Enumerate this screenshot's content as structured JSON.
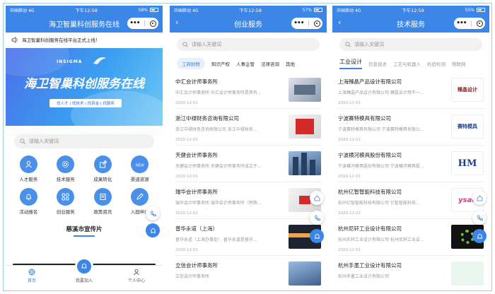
{
  "status_bar": {
    "carrier": "中国移动",
    "network": "4G",
    "time_p1": "下午12:58",
    "time_p2": "下午12:58",
    "time_p3": "下午12:59",
    "battery_p1": "58%",
    "battery_p2": "57%",
    "battery_p3": "55%"
  },
  "phone1": {
    "title": "海卫智巢科创服务在线",
    "notice": "海卫智巢科创服务在线平台正式上线！",
    "banner": {
      "brand": "INSIGMA",
      "headline": "海卫智巢科创服务在线",
      "tagline": "找人才 | 找技术 | 找资金 | 找服务"
    },
    "search_placeholder": "请输入关键词",
    "grid": [
      {
        "label": "人才服务",
        "icon": "person-icon"
      },
      {
        "label": "技术服务",
        "icon": "gear-icon"
      },
      {
        "label": "成果转化",
        "icon": "share-icon"
      },
      {
        "label": "渠道资源",
        "icon": "channel-icon"
      },
      {
        "label": "活动报名",
        "icon": "bell-icon"
      },
      {
        "label": "创业服务",
        "icon": "apps-icon"
      },
      {
        "label": "政策资讯",
        "icon": "news-icon"
      },
      {
        "label": "入园申请",
        "icon": "pencil-icon"
      }
    ],
    "promo_title": "慈溪市宣传片",
    "tabs": [
      {
        "label": "首页"
      },
      {
        "label": "我要加入"
      },
      {
        "label": "个人中心"
      }
    ]
  },
  "phone2": {
    "title": "创业服务",
    "search_placeholder": "请输入关键词",
    "categories": [
      "工商财税",
      "知识产权",
      "人事企管",
      "法律咨询",
      "其他"
    ],
    "items": [
      {
        "title": "中汇会计师事务所",
        "desc": "中汇会计师事务所  中汇会计师事务所是具有...",
        "date": "2020-12-01"
      },
      {
        "title": "浙江中禄财务咨询有限公司",
        "desc": "浙江中禄财务咨询有限公司  浙江中禄财务...",
        "date": "2020-12-01"
      },
      {
        "title": "天健会计师事务所",
        "desc": "天健会计师事务所  天健会计师事务所成立于...",
        "date": "2020-12-01"
      },
      {
        "title": "瑞华会计师事务所",
        "desc": "瑞华会计师事务所  瑞华会计师事务所（特殊...",
        "date": "2020-12-01"
      },
      {
        "title": "普华永道（上海）",
        "desc": "普华永道（上海办事处）  普华永道是普华...",
        "date": "2020-12-01"
      },
      {
        "title": "立信会计师事务所",
        "desc": "立信会计师事务所",
        "date": ""
      }
    ]
  },
  "phone3": {
    "title": "技术服务",
    "search_placeholder": "请输入关键词",
    "categories": [
      "工业设计",
      "信息技术",
      "工艺与机器人",
      "检验检测",
      "物联网"
    ],
    "items": [
      {
        "title": "上海臻晶产品设计有限公司",
        "desc": "上海臻晶产品设计有限公司  臻晶设计用不一...",
        "date": "2020-12-01",
        "logo": "臻晶设计"
      },
      {
        "title": "宁波赛特模具有限公司",
        "desc": "宁波赛特模具有限公司  宁波赛特模具有限公...",
        "date": "2020-12-01",
        "logo": "赛特模具"
      },
      {
        "title": "宁波横河模具股份有限公司",
        "desc": "宁波横河模具股份有限公司  宁波横河模具股...",
        "date": "2020-12-01",
        "logo": "HM"
      },
      {
        "title": "杭州亿智智能科技有限公司",
        "desc": "杭州亿智智能科技有限公司  亿智智能科技...",
        "date": "2020-12-01",
        "logo": "ysae"
      },
      {
        "title": "杭州尼轩工业设计有限公司",
        "desc": "杭州尼轩工业设计有限公司  杭州尼轩工业设...",
        "date": "2020-12-01",
        "logo": ""
      },
      {
        "title": "杭州手墨工业设计有限公司",
        "desc": "杭州手墨工业设计有限公司",
        "date": "",
        "logo": ""
      }
    ]
  },
  "colors": {
    "primary": "#3b86e6",
    "banner_start": "#4b6fe9",
    "banner_end": "#6ec7f6"
  }
}
